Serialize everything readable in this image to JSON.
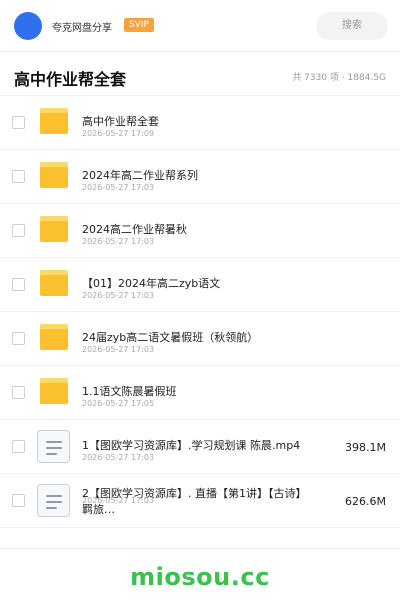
{
  "topbar": {
    "app_name": "夸克网盘分享",
    "badge": "SVIP",
    "search_placeholder": "搜索"
  },
  "header": {
    "title": "高中作业帮全套",
    "summary": "共 7330 项 · 1884.5G"
  },
  "files": [
    {
      "name": "高中作业帮全套",
      "date": "2026-05-27 17:09",
      "size": "",
      "type": "folder"
    },
    {
      "name": "2024年高二作业帮系列",
      "date": "2026-05-27 17:03",
      "size": "",
      "type": "folder"
    },
    {
      "name": "2024高二作业帮暑秋",
      "date": "2026-05-27 17:03",
      "size": "",
      "type": "folder"
    },
    {
      "name": "【01】2024年高二zyb语文",
      "date": "2026-05-27 17:03",
      "size": "",
      "type": "folder"
    },
    {
      "name": "24届zyb高二语文暑假班（秋领航）",
      "date": "2026-05-27 17:03",
      "size": "",
      "type": "folder"
    },
    {
      "name": "1.1语文陈晨暑假班",
      "date": "2026-05-27 17:05",
      "size": "",
      "type": "folder"
    },
    {
      "name": "1【图欧学习资源库】.学习规划课 陈晨.mp4",
      "date": "2026-05-27 17:03",
      "size": "398.1M",
      "type": "video"
    },
    {
      "name": "2【图欧学习资源库】. 直播【第1讲】【古诗】羁旅…",
      "date": "2026-05-27 17:03",
      "size": "626.6M",
      "type": "video"
    }
  ],
  "watermark": "miosou.cc"
}
